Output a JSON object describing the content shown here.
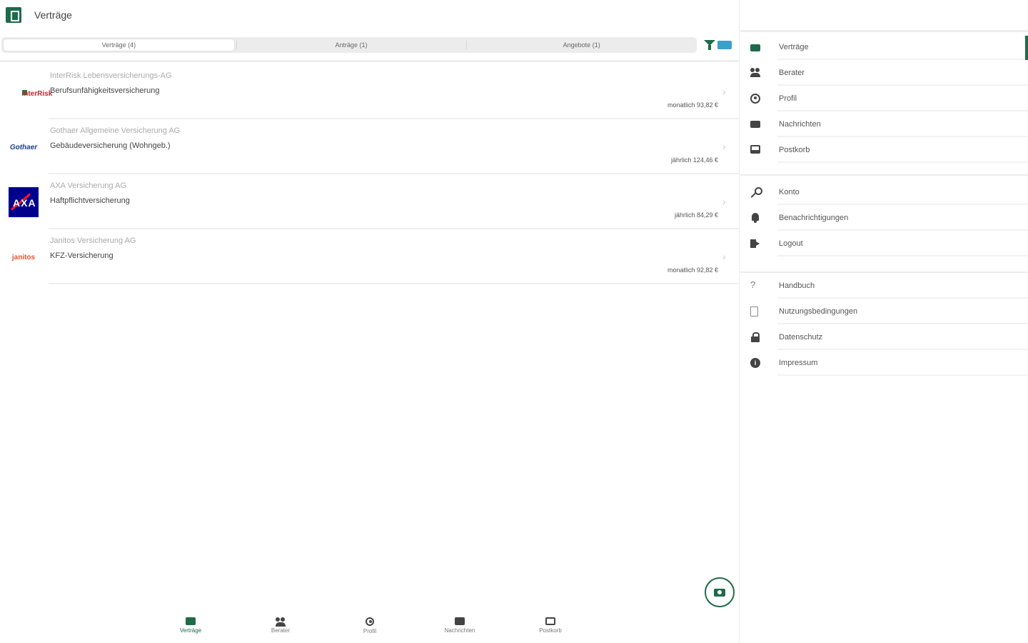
{
  "header": {
    "title": "Verträge"
  },
  "tabs": [
    {
      "label": "Verträge (4)",
      "active": true
    },
    {
      "label": "Anträge (1)",
      "active": false
    },
    {
      "label": "Angebote (1)",
      "active": false
    }
  ],
  "contracts": [
    {
      "company": "InterRisk Lebensversicherungs-AG",
      "product": "Berufsunfähigkeitsversicherung",
      "price": "monatlich 93,82 €",
      "logo": "interrisk"
    },
    {
      "company": "Gothaer Allgemeine Versicherung AG",
      "product": "Gebäudeversicherung (Wohngeb.)",
      "price": "jährlich 124,46 €",
      "logo": "gothaer"
    },
    {
      "company": "AXA Versicherung AG",
      "product": "Haftpflichtversicherung",
      "price": "jährlich 84,29 €",
      "logo": "axa"
    },
    {
      "company": "Janitos Versicherung AG",
      "product": "KFZ-Versicherung",
      "price": "monatlich 92,82 €",
      "logo": "janitos"
    }
  ],
  "logos": {
    "interrisk": "InterRisk",
    "gothaer": "Gothaer",
    "axa": "AXA",
    "janitos": "janitos"
  },
  "bottom_nav": [
    {
      "label": "Verträge",
      "icon": "briefcase-icon",
      "active": true
    },
    {
      "label": "Berater",
      "icon": "people-icon",
      "active": false
    },
    {
      "label": "Profil",
      "icon": "person-icon",
      "active": false
    },
    {
      "label": "Nachrichten",
      "icon": "mail-icon",
      "active": false
    },
    {
      "label": "Postkorb",
      "icon": "inbox-icon",
      "active": false
    }
  ],
  "sidebar": {
    "group1": [
      {
        "label": "Verträge",
        "icon": "briefcase-icon",
        "active": true
      },
      {
        "label": "Berater",
        "icon": "people-icon"
      },
      {
        "label": "Profil",
        "icon": "person-icon"
      },
      {
        "label": "Nachrichten",
        "icon": "mail-icon"
      },
      {
        "label": "Postkorb",
        "icon": "inbox-icon"
      }
    ],
    "group2": [
      {
        "label": "Konto",
        "icon": "key-icon"
      },
      {
        "label": "Benachrichtigungen",
        "icon": "bell-icon"
      },
      {
        "label": "Logout",
        "icon": "logout-icon"
      }
    ],
    "group3": [
      {
        "label": "Handbuch",
        "icon": "question-icon"
      },
      {
        "label": "Nutzungsbedingungen",
        "icon": "document-icon"
      },
      {
        "label": "Datenschutz",
        "icon": "lock-icon"
      },
      {
        "label": "Impressum",
        "icon": "info-icon"
      }
    ]
  },
  "colors": {
    "brand": "#1e6b4a",
    "accent": "#3aa0c8"
  }
}
